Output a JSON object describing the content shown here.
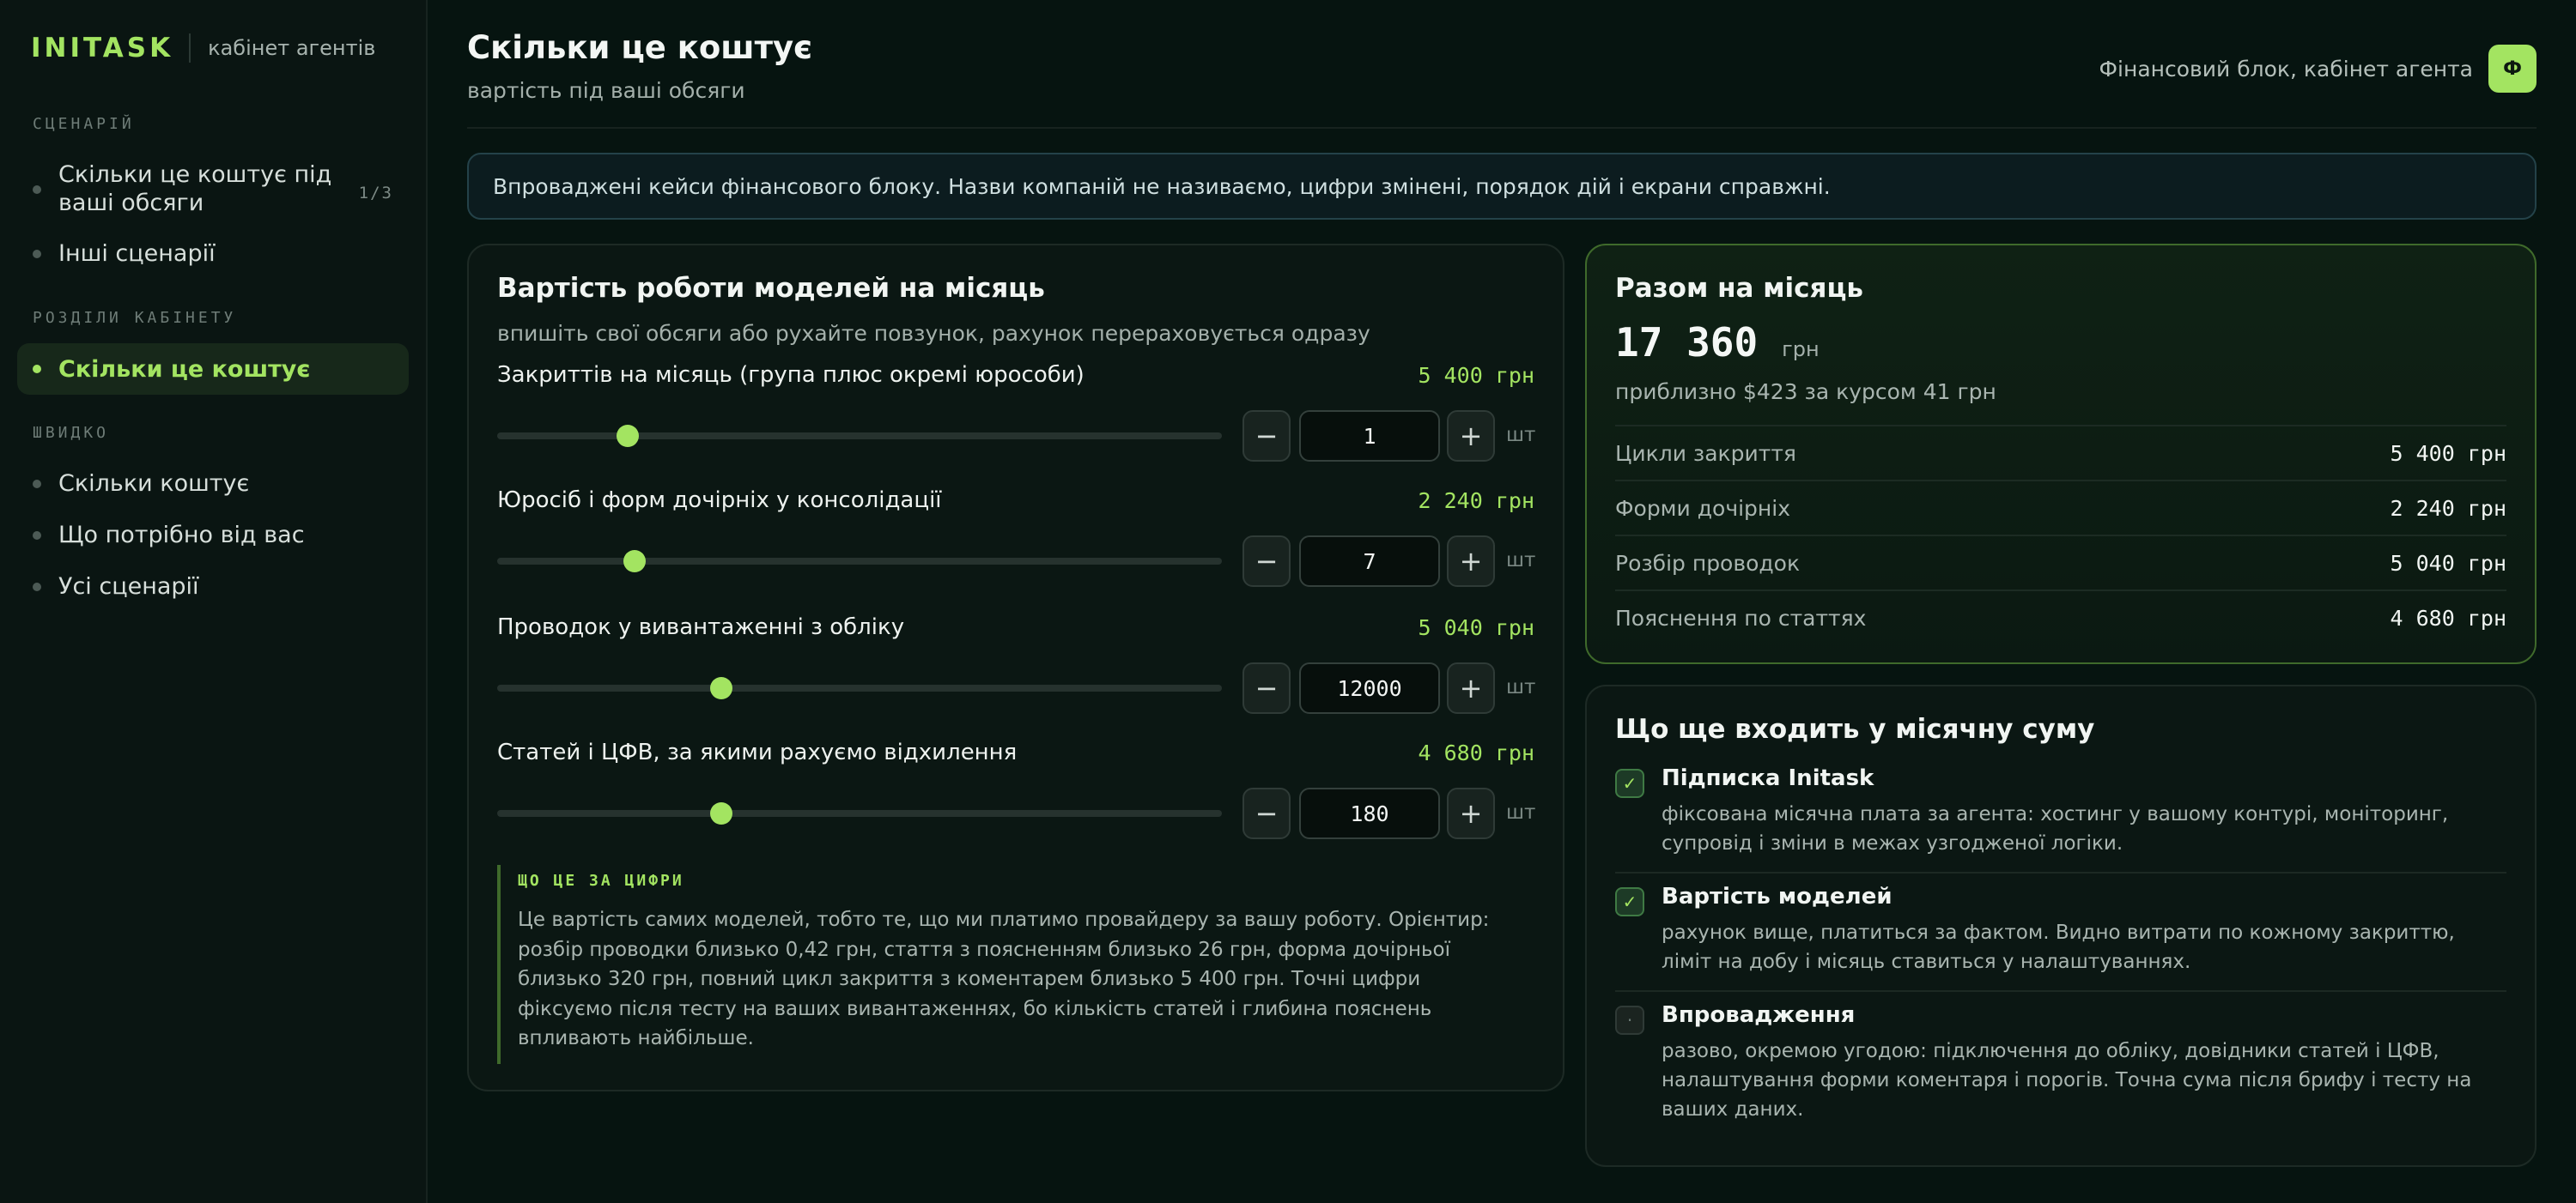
{
  "sidebar": {
    "brand": "INITASK",
    "brand_sub": "кабінет агентів",
    "section_scenario": "СЦЕНАРІЙ",
    "scenario_items": [
      {
        "label": "Скільки це коштує під ваші обсяги",
        "count": "1/3"
      },
      {
        "label": "Інші сценарії"
      }
    ],
    "section_cabinet": "РОЗДІЛИ КАБІНЕТУ",
    "cabinet_items": [
      {
        "label": "Скільки це коштує"
      }
    ],
    "section_quick": "ШВИДКО",
    "quick_items": [
      {
        "label": "Скільки коштує"
      },
      {
        "label": "Що потрібно від вас"
      },
      {
        "label": "Усі сценарії"
      }
    ]
  },
  "header": {
    "title": "Скільки це коштує",
    "subtitle": "вартість під ваші обсяги",
    "context": "Фінансовий блок, кабінет агента",
    "avatar_letter": "Ф"
  },
  "notice": "Впроваджені кейси фінансового блоку. Назви компаній не називаємо, цифри змінені, порядок дій і екрани справжні.",
  "calculator": {
    "title": "Вартість роботи моделей на місяць",
    "subtitle": "впишіть свої обсяги або рухайте повзунок, рахунок перераховується одразу",
    "unit": "шт",
    "minus": "−",
    "plus": "+",
    "params": [
      {
        "label": "Закриттів на місяць (група плюс окремі юрособи)",
        "price": "5 400 грн",
        "value": "1",
        "level": 0.18
      },
      {
        "label": "Юросіб і форм дочірніх у консолідації",
        "price": "2 240 грн",
        "value": "7",
        "level": 0.189
      },
      {
        "label": "Проводок у вивантаженні з обліку",
        "price": "5 040 грн",
        "value": "12000",
        "level": 0.309
      },
      {
        "label": "Статей і ЦФВ, за якими рахуємо відхилення",
        "price": "4 680 грн",
        "value": "180",
        "level": 0.309
      }
    ],
    "explain_title": "ЩО ЦЕ ЗА ЦИФРИ",
    "explain_text": "Це вартість самих моделей, тобто те, що ми платимо провайдеру за вашу роботу. Орієнтир: розбір проводки близько 0,42 грн, стаття з поясненням близько 26 грн, форма дочірньої близько 320 грн, повний цикл закриття з коментарем близько 5 400 грн. Точні цифри фіксуємо після тесту на ваших вивантаженнях, бо кількість статей і глибина пояснень впливають найбільше."
  },
  "total": {
    "title": "Разом на місяць",
    "value": "17 360",
    "currency": "грн",
    "approx": "приблизно $423 за курсом 41 грн",
    "rows": [
      {
        "label": "Цикли закриття",
        "value": "5 400 грн"
      },
      {
        "label": "Форми дочірніх",
        "value": "2 240 грн"
      },
      {
        "label": "Розбір проводок",
        "value": "5 040 грн"
      },
      {
        "label": "Пояснення по статтях",
        "value": "4 680 грн"
      }
    ]
  },
  "included": {
    "title": "Що ще входить у місячну суму",
    "items": [
      {
        "title": "Підписка Initask",
        "desc": "фіксована місячна плата за агента: хостинг у вашому контурі, моніторинг, супровід і зміни в межах узгодженої логіки.",
        "check": "✓"
      },
      {
        "title": "Вартість моделей",
        "desc": "рахунок вище, платиться за фактом. Видно витрати по кожному закриттю, ліміт на добу і місяць ставиться у налаштуваннях.",
        "check": "✓"
      },
      {
        "title": "Впровадження",
        "desc": "разово, окремою угодою: підключення до обліку, довідники статей і ЦФВ, налаштування форми коментаря і порогів. Точна сума після брифу і тесту на ваших даних.",
        "check": "·"
      }
    ]
  },
  "colors": {
    "accent": "#a3e461",
    "background": "#061410",
    "sidebar": "#0a1512"
  }
}
